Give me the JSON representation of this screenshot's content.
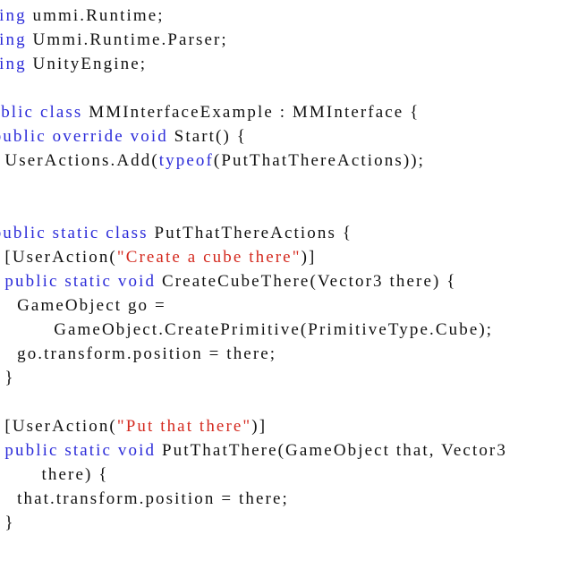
{
  "document": {
    "type": "code-listing",
    "language": "C#",
    "colors": {
      "keyword": "#2b2bd9",
      "string": "#d42a1f",
      "plain": "#111111",
      "background": "#ffffff"
    },
    "lines": [
      [
        {
          "t": "kw",
          "v": "using"
        },
        {
          "t": "plain",
          "v": " ummi.Runtime;"
        }
      ],
      [
        {
          "t": "kw",
          "v": "using"
        },
        {
          "t": "plain",
          "v": " Ummi.Runtime.Parser;"
        }
      ],
      [
        {
          "t": "kw",
          "v": "using"
        },
        {
          "t": "plain",
          "v": " UnityEngine;"
        }
      ],
      [],
      [
        {
          "t": "kw",
          "v": "public"
        },
        {
          "t": "plain",
          "v": " "
        },
        {
          "t": "kw",
          "v": "class"
        },
        {
          "t": "plain",
          "v": " MMInterfaceExample : MMInterface {"
        }
      ],
      [
        {
          "t": "plain",
          "v": "  "
        },
        {
          "t": "kw",
          "v": "public"
        },
        {
          "t": "plain",
          "v": " "
        },
        {
          "t": "kw",
          "v": "override"
        },
        {
          "t": "plain",
          "v": " "
        },
        {
          "t": "kw",
          "v": "void"
        },
        {
          "t": "plain",
          "v": " Start() {"
        }
      ],
      [
        {
          "t": "plain",
          "v": "    UserActions.Add("
        },
        {
          "t": "kw",
          "v": "typeof"
        },
        {
          "t": "plain",
          "v": "(PutThatThereActions));"
        }
      ],
      [],
      [],
      [
        {
          "t": "plain",
          "v": "  "
        },
        {
          "t": "kw",
          "v": "public"
        },
        {
          "t": "plain",
          "v": " "
        },
        {
          "t": "kw",
          "v": "static"
        },
        {
          "t": "plain",
          "v": " "
        },
        {
          "t": "kw",
          "v": "class"
        },
        {
          "t": "plain",
          "v": " PutThatThereActions {"
        }
      ],
      [
        {
          "t": "plain",
          "v": "    [UserAction("
        },
        {
          "t": "str",
          "v": "\"Create a cube there\""
        },
        {
          "t": "plain",
          "v": ")]"
        }
      ],
      [
        {
          "t": "plain",
          "v": "    "
        },
        {
          "t": "kw",
          "v": "public"
        },
        {
          "t": "plain",
          "v": " "
        },
        {
          "t": "kw",
          "v": "static"
        },
        {
          "t": "plain",
          "v": " "
        },
        {
          "t": "kw",
          "v": "void"
        },
        {
          "t": "plain",
          "v": " CreateCubeThere(Vector3 there) {"
        }
      ],
      [
        {
          "t": "plain",
          "v": "      GameObject go ="
        }
      ],
      [
        {
          "t": "plain",
          "v": "            GameObject.CreatePrimitive(PrimitiveType.Cube);"
        }
      ],
      [
        {
          "t": "plain",
          "v": "      go.transform.position = there;"
        }
      ],
      [
        {
          "t": "plain",
          "v": "    }"
        }
      ],
      [],
      [
        {
          "t": "plain",
          "v": "    [UserAction("
        },
        {
          "t": "str",
          "v": "\"Put that there\""
        },
        {
          "t": "plain",
          "v": ")]"
        }
      ],
      [
        {
          "t": "plain",
          "v": "    "
        },
        {
          "t": "kw",
          "v": "public"
        },
        {
          "t": "plain",
          "v": " "
        },
        {
          "t": "kw",
          "v": "static"
        },
        {
          "t": "plain",
          "v": " "
        },
        {
          "t": "kw",
          "v": "void"
        },
        {
          "t": "plain",
          "v": " PutThatThere(GameObject that, Vector3"
        }
      ],
      [
        {
          "t": "plain",
          "v": "          there) {"
        }
      ],
      [
        {
          "t": "plain",
          "v": "      that.transform.position = there;"
        }
      ],
      [
        {
          "t": "plain",
          "v": "    }"
        }
      ]
    ]
  }
}
